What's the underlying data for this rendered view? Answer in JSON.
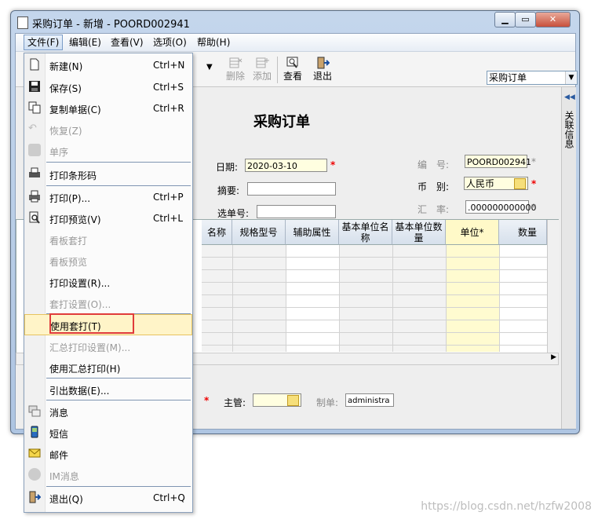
{
  "window": {
    "title": "采购订单 - 新增 - POORD002941"
  },
  "menubar": {
    "items": [
      "文件(F)",
      "编辑(E)",
      "查看(V)",
      "选项(O)",
      "帮助(H)"
    ]
  },
  "toolbar": {
    "delete_label": "删除",
    "add_label": "添加",
    "view_label": "查看",
    "exit_label": "退出",
    "doc_type_value": "采购订单"
  },
  "form": {
    "heading": "采购订单",
    "date_label": "日期:",
    "date_value": "2020-03-10",
    "summary_label": "摘要:",
    "select_label": "选单号:",
    "number_label": "编　号:",
    "number_value": "POORD002941",
    "currency_label": "币　别:",
    "currency_value": "人民币",
    "rate_label": "汇　率:",
    "rate_value": ".000000000000",
    "manager_label": "主管:",
    "maker_label": "制单:",
    "maker_value": "administra",
    "side_label": "关联信息"
  },
  "grid": {
    "columns": [
      "名称",
      "规格型号",
      "辅助属性",
      "基本单位名称",
      "基本单位数量",
      "单位*",
      "数量"
    ]
  },
  "file_menu": {
    "items": [
      {
        "label": "新建(N)",
        "shortcut": "Ctrl+N",
        "icon": "new-doc-icon",
        "disabled": false
      },
      {
        "label": "保存(S)",
        "shortcut": "Ctrl+S",
        "icon": "save-icon",
        "disabled": false
      },
      {
        "label": "复制单据(C)",
        "shortcut": "Ctrl+R",
        "icon": "copy-icon",
        "disabled": false
      },
      {
        "label": "恢复(Z)",
        "shortcut": "",
        "icon": "undo-icon",
        "disabled": true
      },
      {
        "label": "单序",
        "shortcut": "",
        "icon": "sequence-icon",
        "disabled": true
      },
      {
        "label": "打印条形码",
        "shortcut": "",
        "icon": "barcode-printer-icon",
        "disabled": false
      },
      {
        "label": "打印(P)...",
        "shortcut": "Ctrl+P",
        "icon": "printer-icon",
        "disabled": false
      },
      {
        "label": "打印预览(V)",
        "shortcut": "Ctrl+L",
        "icon": "print-preview-icon",
        "disabled": false
      },
      {
        "label": "看板套打",
        "shortcut": "",
        "icon": "",
        "disabled": true
      },
      {
        "label": "看板预览",
        "shortcut": "",
        "icon": "",
        "disabled": true
      },
      {
        "label": "打印设置(R)...",
        "shortcut": "",
        "icon": "",
        "disabled": false
      },
      {
        "label": "套打设置(O)...",
        "shortcut": "",
        "icon": "",
        "disabled": true
      },
      {
        "label": "使用套打(T)",
        "shortcut": "",
        "icon": "",
        "disabled": false
      },
      {
        "label": "汇总打印设置(M)...",
        "shortcut": "",
        "icon": "",
        "disabled": true
      },
      {
        "label": "使用汇总打印(H)",
        "shortcut": "",
        "icon": "",
        "disabled": false
      },
      {
        "label": "引出数据(E)...",
        "shortcut": "",
        "icon": "",
        "disabled": false
      },
      {
        "label": "消息",
        "shortcut": "",
        "icon": "message-icon",
        "disabled": false
      },
      {
        "label": "短信",
        "shortcut": "",
        "icon": "sms-icon",
        "disabled": false
      },
      {
        "label": "邮件",
        "shortcut": "",
        "icon": "mail-icon",
        "disabled": false
      },
      {
        "label": "IM消息",
        "shortcut": "",
        "icon": "im-icon",
        "disabled": true
      },
      {
        "label": "退出(Q)",
        "shortcut": "Ctrl+Q",
        "icon": "exit-icon",
        "disabled": false
      }
    ]
  },
  "watermark": "https://blog.csdn.net/hzfw2008",
  "colors": {
    "highlight": "#fff4c8",
    "annotation_box": "#e03b3b"
  }
}
